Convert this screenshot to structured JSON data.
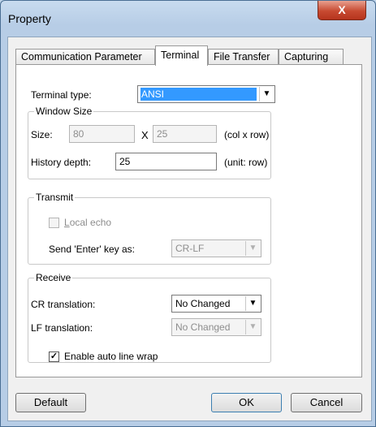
{
  "window": {
    "title": "Property",
    "close_glyph": "X"
  },
  "tabs": [
    {
      "label": "Communication Parameter"
    },
    {
      "label": "Terminal"
    },
    {
      "label": "File Transfer"
    },
    {
      "label": "Capturing"
    }
  ],
  "terminal": {
    "type_label": "Terminal type:",
    "type_value": "ANSI",
    "window_size": {
      "title": "Window Size",
      "size_label": "Size:",
      "cols": "80",
      "x_label": "X",
      "rows": "25",
      "size_unit": "(col x row)",
      "history_label": "History depth:",
      "history_value": "25",
      "history_unit": "(unit: row)"
    },
    "transmit": {
      "title": "Transmit",
      "local_echo_label": "Local echo",
      "local_echo_checked": false,
      "send_enter_label": "Send 'Enter' key  as:",
      "send_enter_value": "CR-LF"
    },
    "receive": {
      "title": "Receive",
      "cr_label": "CR translation:",
      "cr_value": "No Changed",
      "lf_label": "LF translation:",
      "lf_value": "No Changed"
    },
    "auto_wrap_label": "Enable auto line wrap",
    "auto_wrap_checked": true
  },
  "buttons": {
    "default": "Default",
    "ok": "OK",
    "cancel": "Cancel"
  },
  "icons": {
    "checkmark": "✓-icon",
    "dropdown": "chevron-down-icon"
  }
}
